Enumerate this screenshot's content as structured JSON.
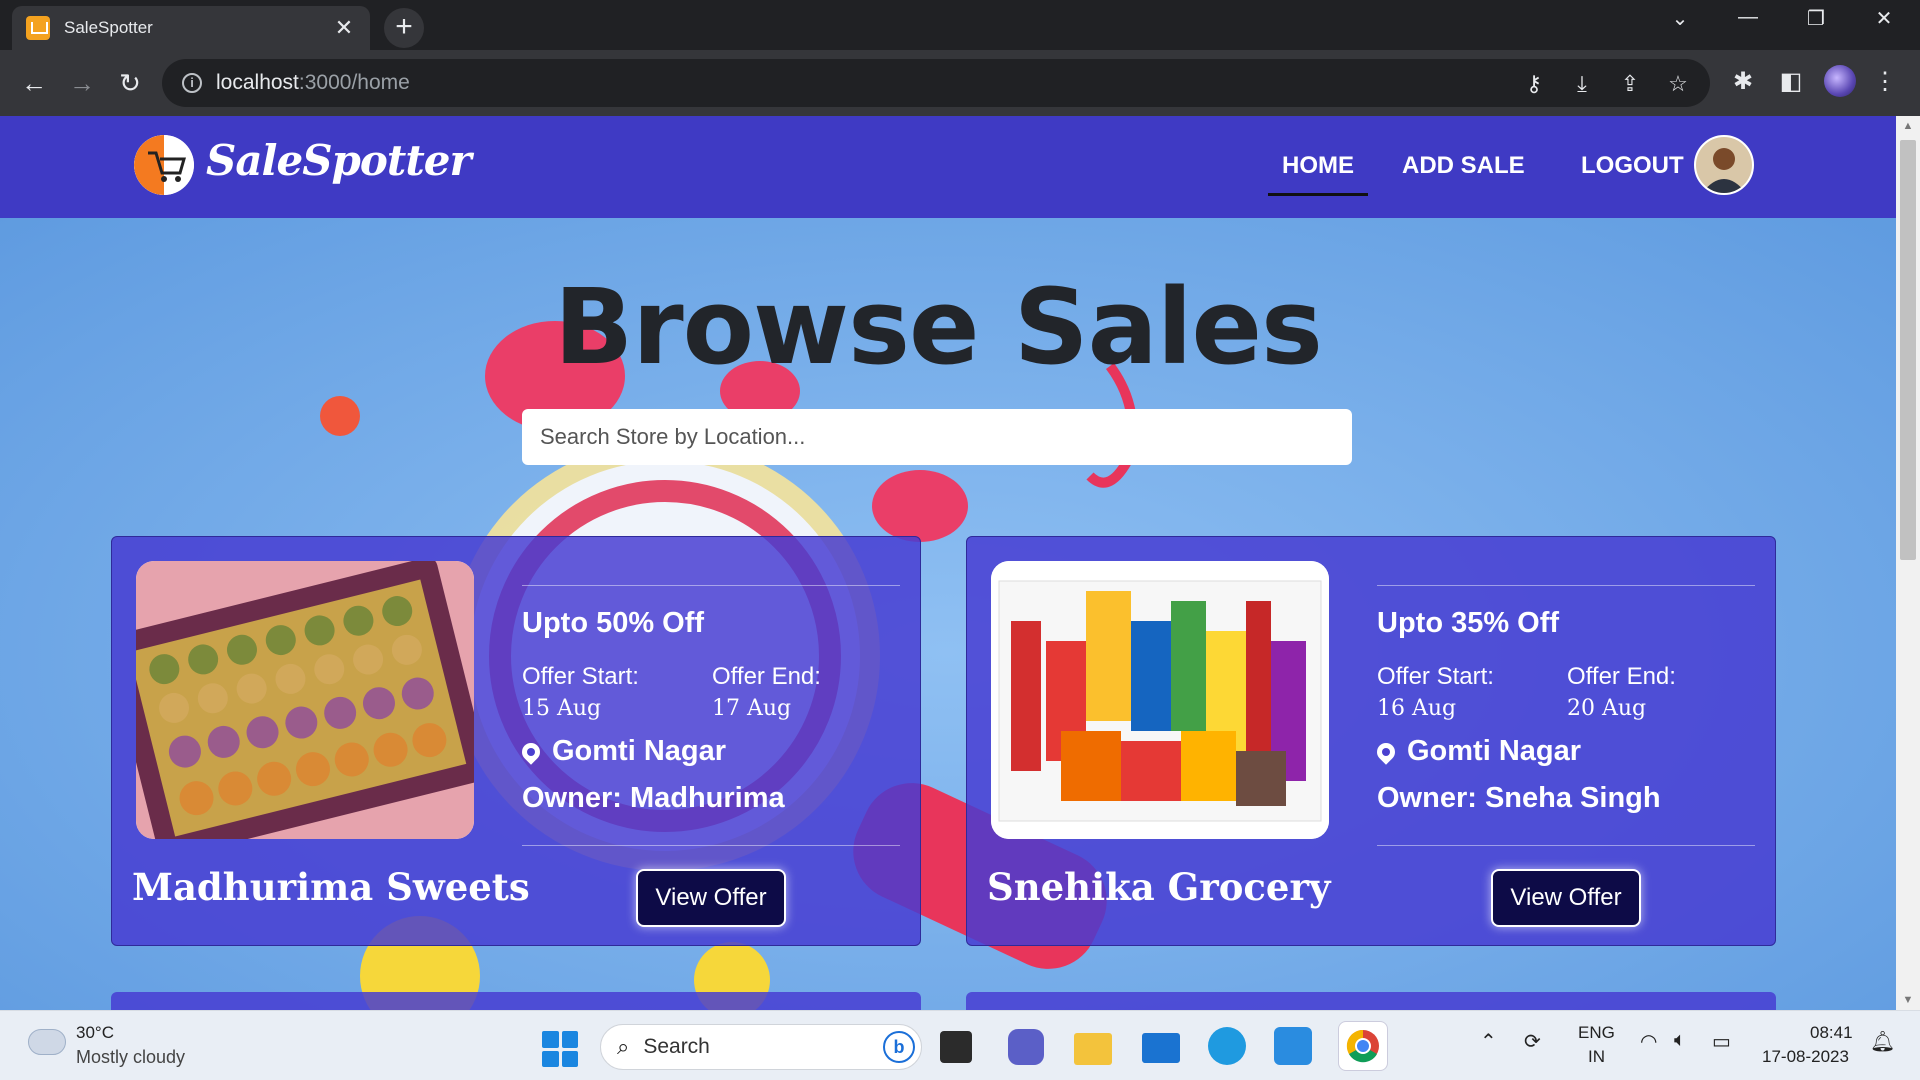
{
  "browser": {
    "tab_title": "SaleSpotter",
    "tab_close": "✕",
    "new_tab": "+",
    "url_host": "localhost",
    "url_path": ":3000/home"
  },
  "site": {
    "brand": "SaleSpotter",
    "nav": {
      "home": "HOME",
      "add_sale": "ADD SALE",
      "logout": "LOGOUT"
    },
    "title": "Browse Sales",
    "search_placeholder": "Search Store by Location...",
    "offer_start_label": "Offer Start:",
    "offer_end_label": "Offer End:",
    "view_offer_label": "View Offer"
  },
  "cards": [
    {
      "discount": "Upto 50% Off",
      "start": "15 Aug",
      "end": "17 Aug",
      "location": "Gomti Nagar",
      "owner": "Owner: Madhurima",
      "name": "Madhurima Sweets"
    },
    {
      "discount": "Upto 35% Off",
      "start": "16 Aug",
      "end": "20 Aug",
      "location": "Gomti Nagar",
      "owner": "Owner: Sneha Singh",
      "name": "Snehika Grocery"
    }
  ],
  "taskbar": {
    "temperature": "30°C",
    "condition": "Mostly cloudy",
    "search_label": "Search",
    "lang_top": "ENG",
    "lang_bottom": "IN",
    "time": "08:41",
    "date": "17-08-2023"
  },
  "colors": {
    "navbar": "#3f3ac4",
    "page_bg": "#6ea7e6",
    "card_bg": "#463cd2",
    "button_bg": "#0d0b47"
  }
}
